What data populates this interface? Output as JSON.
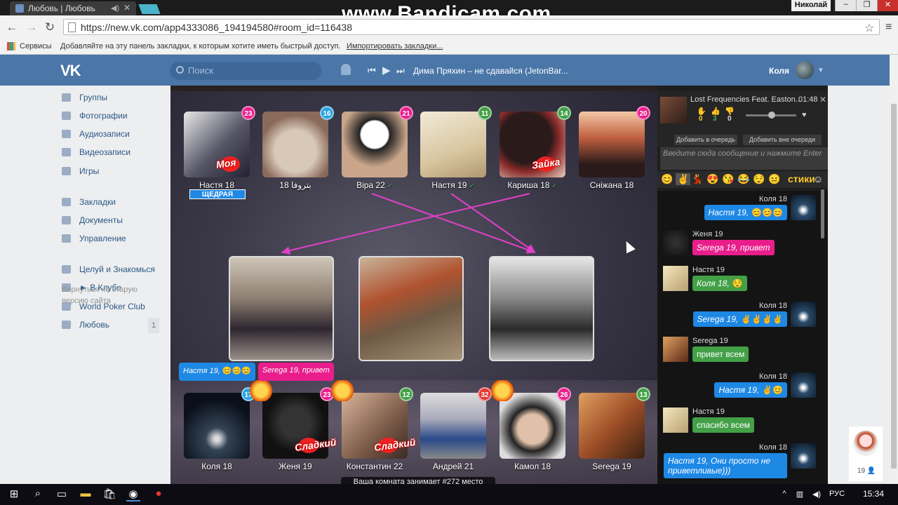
{
  "browser": {
    "tab_title": "Любовь | Любовь",
    "url": "https://new.vk.com/app4333086_194194580#room_id=116438",
    "watermark": "www.Bandicam.com",
    "window_user": "Николай",
    "bookmarks": {
      "services": "Сервисы",
      "hint": "Добавляйте на эту панель закладки, к которым хотите иметь быстрый доступ.",
      "import_link": "Импортировать закладки..."
    }
  },
  "vk": {
    "search_placeholder": "Поиск",
    "now_playing": "Дима Пряхин – не сдавайся (JetonBar...",
    "user_name": "Коля",
    "menu": [
      {
        "label": "Группы",
        "icon": "groups-icon"
      },
      {
        "label": "Фотографии",
        "icon": "camera-icon"
      },
      {
        "label": "Аудиозаписи",
        "icon": "music-note-icon"
      },
      {
        "label": "Видеозаписи",
        "icon": "film-icon"
      },
      {
        "label": "Игры",
        "icon": "gamepad-icon"
      },
      {
        "label": "Закладки",
        "icon": "star-icon"
      },
      {
        "label": "Документы",
        "icon": "document-icon"
      },
      {
        "label": "Управление",
        "icon": "gamepad-icon"
      },
      {
        "label": "Целуй и Знакомься",
        "icon": "app-grid-icon"
      },
      {
        "label": "► В Клубе",
        "icon": "anchor-icon"
      },
      {
        "label": "World Poker Club",
        "icon": "app-icon"
      },
      {
        "label": "Любовь",
        "icon": "app-grid-icon",
        "count": "1"
      }
    ],
    "old_site_link": "Вернуться на старую версию сайта",
    "friend_count": "19"
  },
  "game": {
    "top_users": [
      {
        "name": "Настя 18",
        "badge": "23",
        "badge_color": "#e91e8c",
        "sticker": "Моя",
        "verified": false
      },
      {
        "name": "18 بتروفا",
        "badge": "16",
        "badge_color": "#29a3e0",
        "verified": false
      },
      {
        "name": "Віра 22",
        "badge": "21",
        "badge_color": "#e91e8c",
        "verified": true
      },
      {
        "name": "Настя 19",
        "badge": "11",
        "badge_color": "#43a047",
        "verified": true
      },
      {
        "name": "Кариша 18",
        "badge": "14",
        "badge_color": "#43a047",
        "sticker": "Зайка",
        "verified": true
      },
      {
        "name": "Сніжана 18",
        "badge": "20",
        "badge_color": "#e91e8c",
        "verified": false
      }
    ],
    "generous_label": "ЩЕДРАЯ",
    "bottom_users": [
      {
        "name": "Коля 18",
        "badge": "17",
        "badge_color": "#29a3e0"
      },
      {
        "name": "Женя 19",
        "badge": "23",
        "badge_color": "#e91e8c",
        "sticker": "Сладкий"
      },
      {
        "name": "Константин 22",
        "badge": "12",
        "badge_color": "#43a047",
        "sticker": "Сладкий"
      },
      {
        "name": "Андрей 21",
        "badge": "32",
        "badge_color": "#e53935"
      },
      {
        "name": "Камол 18",
        "badge": "26",
        "badge_color": "#e91e8c"
      },
      {
        "name": "Serega 19",
        "badge": "13",
        "badge_color": "#43a047"
      }
    ],
    "speech_bubbles": [
      {
        "name": "Настя 19,",
        "emoji": "😊😊😊",
        "color": "#1e88e5"
      },
      {
        "name": "Serega 19,",
        "text": "привет",
        "color": "#e91e8c"
      }
    ],
    "room_rank": "Ваша комната занимает #272 место"
  },
  "chat": {
    "track_title": "Lost Frequencies Feat. Easton...",
    "track_time": "01:48",
    "votes": [
      "0",
      "3",
      "0"
    ],
    "queue_button": "Добавить в очередь",
    "out_of_queue_button": "Добавить вне очереди",
    "input_placeholder": "Введите сюда сообщение и нажмите Enter",
    "stickers_label": "стики",
    "messages": [
      {
        "user": "Коля 18",
        "text": "Настя 19,",
        "emoji": "😊😊😊",
        "color": "#1e88e5",
        "side": "right"
      },
      {
        "user": "Женя 19",
        "text": "Serega 19, привет",
        "color": "#e91e8c",
        "side": "left"
      },
      {
        "user": "Настя 19",
        "text": "Коля 18,",
        "emoji": "😌",
        "color": "#43a047",
        "side": "left"
      },
      {
        "user": "Коля 18",
        "text": "Serega 19,",
        "emoji": "✌✌✌✌",
        "color": "#1e88e5",
        "side": "right"
      },
      {
        "user": "Serega 19",
        "text": "привет всем",
        "color": "#43a047",
        "side": "left"
      },
      {
        "user": "Коля 18",
        "text": "Настя 19,",
        "emoji": "✌😊",
        "color": "#1e88e5",
        "side": "right"
      },
      {
        "user": "Настя 19",
        "text": "спасибо всем",
        "color": "#43a047",
        "side": "left"
      },
      {
        "user": "Коля 18",
        "text": "Настя 19, Они просто не приветливые)))",
        "color": "#1e88e5",
        "side": "right"
      }
    ]
  },
  "taskbar": {
    "language": "РУС",
    "time": "15:34"
  }
}
